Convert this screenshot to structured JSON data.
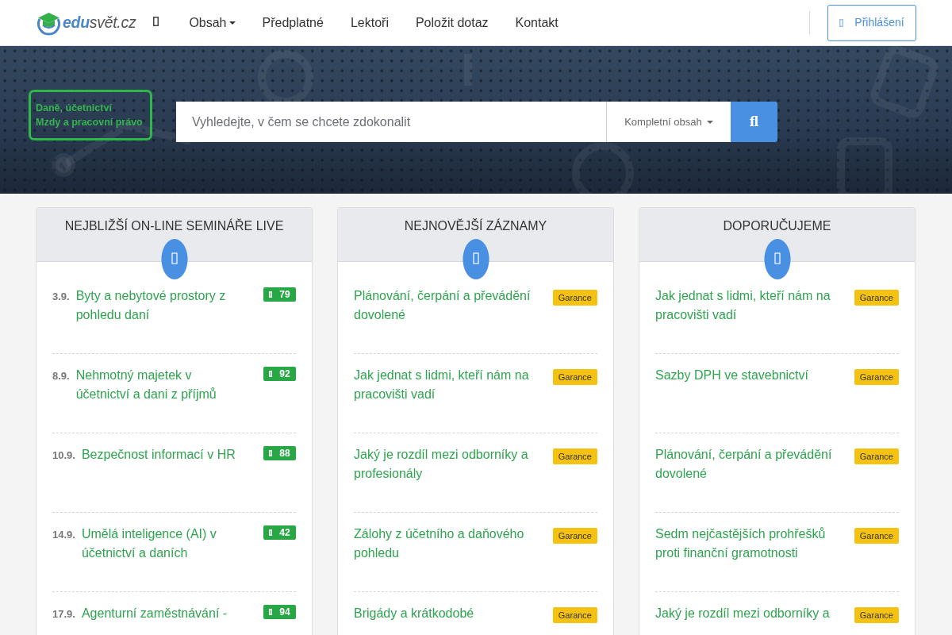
{
  "header": {
    "logo": "**edu**svět.cz",
    "nav": [
      {
        "kind": "icon"
      },
      {
        "kind": "link",
        "label": "Obsah",
        "has_menu": true
      },
      {
        "kind": "link",
        "label": "Předplatné",
        "has_menu": false
      },
      {
        "kind": "link",
        "label": "Lektoři",
        "has_menu": false
      },
      {
        "kind": "link",
        "label": "Položit dotaz",
        "has_menu": false
      },
      {
        "kind": "link",
        "label": "Kontakt",
        "has_menu": false
      }
    ],
    "login_button": "Přihlášení"
  },
  "hero": {
    "category_box": [
      "Daně, účetnictví",
      "Mzdy a pracovní právo"
    ],
    "search": {
      "placeholder": "Vyhledejte, v čem se chcete zdokonalit",
      "scope": "Kompletní obsah",
      "button": "fl"
    }
  },
  "columns": [
    {
      "title": "NEJBLIŽŠÍ ON-LINE SEMINÁŘE LIVE",
      "items": [
        {
          "kind": "seminar",
          "date": "3.9.",
          "title": "Byty a nebytové prostory z pohledu daní",
          "count": "79"
        },
        {
          "kind": "seminar",
          "date": "8.9.",
          "title": "Nehmotný majetek v účetnictví a dani z příjmů",
          "count": "92"
        },
        {
          "kind": "seminar",
          "date": "10.9.",
          "title": "Bezpečnost informací v HR",
          "count": "88"
        },
        {
          "kind": "seminar",
          "date": "14.9.",
          "title": "Umělá inteligence (AI) v účetnictví a daních",
          "count": "42"
        },
        {
          "kind": "seminar",
          "date": "17.9.",
          "title": "Agenturní zaměstnávání -",
          "count": "94"
        }
      ]
    },
    {
      "title": "NEJNOVĚJŠÍ ZÁZNAMY",
      "items": [
        {
          "kind": "recording",
          "title": "Plánování, čerpání a převádění dovolené",
          "badge": "Garance"
        },
        {
          "kind": "recording",
          "title": "Jak jednat s lidmi, kteří nám na pracovišti vadí",
          "badge": "Garance"
        },
        {
          "kind": "recording",
          "title": "Jaký je rozdíl mezi odborníky a profesionály",
          "badge": "Garance"
        },
        {
          "kind": "recording",
          "title": "Zálohy z účetního a daňového pohledu",
          "badge": "Garance"
        },
        {
          "kind": "recording",
          "title": "Brigády a krátkodobé",
          "badge": "Garance"
        }
      ]
    },
    {
      "title": "DOPORUČUJEME",
      "items": [
        {
          "kind": "recording",
          "title": "Jak jednat s lidmi, kteří nám na pracovišti vadí",
          "badge": "Garance"
        },
        {
          "kind": "recording",
          "title": "Sazby DPH ve stavebnictví",
          "badge": "Garance"
        },
        {
          "kind": "recording",
          "title": "Plánování, čerpání a převádění dovolené",
          "badge": "Garance"
        },
        {
          "kind": "recording",
          "title": "Sedm nejčastějších prohřešků proti finanční gramotnosti",
          "badge": "Garance"
        },
        {
          "kind": "recording",
          "title": "Jaký je rozdíl mezi odborníky a",
          "badge": "Garance"
        }
      ]
    }
  ]
}
